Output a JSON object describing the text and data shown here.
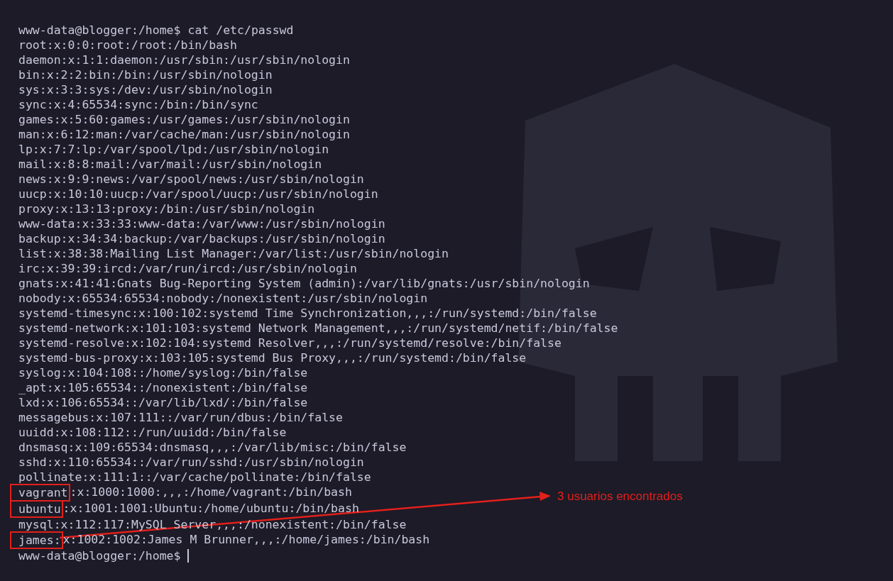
{
  "terminal": {
    "command_prompt": "www-data@blogger:/home$",
    "command": "cat /etc/passwd",
    "lines": [
      {
        "text": "root:x:0:0:root:/root:/bin/bash"
      },
      {
        "text": "daemon:x:1:1:daemon:/usr/sbin:/usr/sbin/nologin"
      },
      {
        "text": "bin:x:2:2:bin:/bin:/usr/sbin/nologin"
      },
      {
        "text": "sys:x:3:3:sys:/dev:/usr/sbin/nologin"
      },
      {
        "text": "sync:x:4:65534:sync:/bin:/bin/sync"
      },
      {
        "text": "games:x:5:60:games:/usr/games:/usr/sbin/nologin"
      },
      {
        "text": "man:x:6:12:man:/var/cache/man:/usr/sbin/nologin"
      },
      {
        "text": "lp:x:7:7:lp:/var/spool/lpd:/usr/sbin/nologin"
      },
      {
        "text": "mail:x:8:8:mail:/var/mail:/usr/sbin/nologin"
      },
      {
        "text": "news:x:9:9:news:/var/spool/news:/usr/sbin/nologin"
      },
      {
        "text": "uucp:x:10:10:uucp:/var/spool/uucp:/usr/sbin/nologin"
      },
      {
        "text": "proxy:x:13:13:proxy:/bin:/usr/sbin/nologin"
      },
      {
        "text": "www-data:x:33:33:www-data:/var/www:/usr/sbin/nologin"
      },
      {
        "text": "backup:x:34:34:backup:/var/backups:/usr/sbin/nologin"
      },
      {
        "text": "list:x:38:38:Mailing List Manager:/var/list:/usr/sbin/nologin"
      },
      {
        "text": "irc:x:39:39:ircd:/var/run/ircd:/usr/sbin/nologin"
      },
      {
        "text": "gnats:x:41:41:Gnats Bug-Reporting System (admin):/var/lib/gnats:/usr/sbin/nologin"
      },
      {
        "text": "nobody:x:65534:65534:nobody:/nonexistent:/usr/sbin/nologin"
      },
      {
        "text": "systemd-timesync:x:100:102:systemd Time Synchronization,,,:/run/systemd:/bin/false"
      },
      {
        "text": "systemd-network:x:101:103:systemd Network Management,,,:/run/systemd/netif:/bin/false"
      },
      {
        "text": "systemd-resolve:x:102:104:systemd Resolver,,,:/run/systemd/resolve:/bin/false"
      },
      {
        "text": "systemd-bus-proxy:x:103:105:systemd Bus Proxy,,,:/run/systemd:/bin/false"
      },
      {
        "text": "syslog:x:104:108::/home/syslog:/bin/false"
      },
      {
        "text": "_apt:x:105:65534::/nonexistent:/bin/false"
      },
      {
        "text": "lxd:x:106:65534::/var/lib/lxd/:/bin/false"
      },
      {
        "text": "messagebus:x:107:111::/var/run/dbus:/bin/false"
      },
      {
        "text": "uuidd:x:108:112::/run/uuidd:/bin/false"
      },
      {
        "text": "dnsmasq:x:109:65534:dnsmasq,,,:/var/lib/misc:/bin/false"
      },
      {
        "text": "sshd:x:110:65534::/var/run/sshd:/usr/sbin/nologin"
      },
      {
        "text": "pollinate:x:111:1::/var/cache/pollinate:/bin/false"
      },
      {
        "highlight": "vagrant",
        "text": ":x:1000:1000:,,,:/home/vagrant:/bin/bash"
      },
      {
        "highlight": "ubuntu",
        "text": ":x:1001:1001:Ubuntu:/home/ubuntu:/bin/bash"
      },
      {
        "text": "mysql:x:112:117:MySQL Server,,,:/nonexistent:/bin/false"
      },
      {
        "highlight": "james:",
        "text": "x:1002:1002:James M Brunner,,,:/home/james:/bin/bash"
      }
    ],
    "final_prompt": "www-data@blogger:/home$"
  },
  "annotation": {
    "label": "3 usuarios encontrados"
  }
}
